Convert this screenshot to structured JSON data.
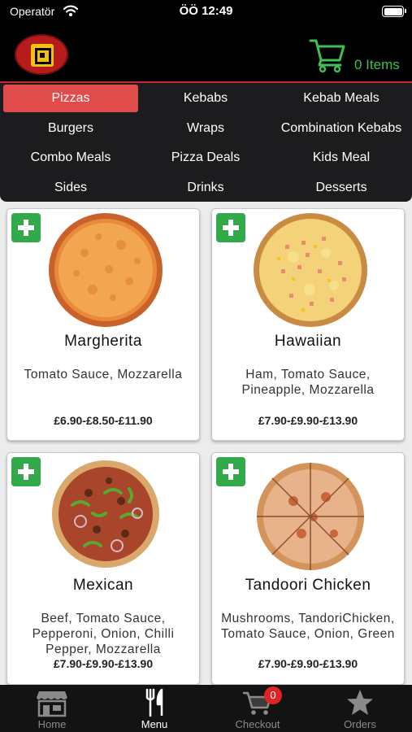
{
  "status_bar": {
    "carrier": "Operatör",
    "time": "ÖÖ 12:49"
  },
  "header": {
    "cart_count_label": "0 Items"
  },
  "categories": [
    {
      "label": "Pizzas",
      "active": true
    },
    {
      "label": "Kebabs"
    },
    {
      "label": "Kebab Meals"
    },
    {
      "label": "Burgers"
    },
    {
      "label": "Wraps"
    },
    {
      "label": "Combination Kebabs"
    },
    {
      "label": "Combo Meals"
    },
    {
      "label": "Pizza Deals"
    },
    {
      "label": "Kids Meal"
    },
    {
      "label": "Sides"
    },
    {
      "label": "Drinks"
    },
    {
      "label": "Desserts"
    }
  ],
  "products": [
    {
      "name": "Margherita",
      "description": "Tomato Sauce, Mozzarella",
      "price": "£6.90-£8.50-£11.90"
    },
    {
      "name": "Hawaiian",
      "description": "Ham, Tomato Sauce, Pineapple, Mozzarella",
      "price": "£7.90-£9.90-£13.90"
    },
    {
      "name": "Mexican",
      "description": "Beef, Tomato Sauce, Pepperoni, Onion, Chilli Pepper, Mozzarella",
      "price": "£7.90-£9.90-£13.90"
    },
    {
      "name": "Tandoori Chicken",
      "description": "Mushrooms, TandoriChicken, Tomato Sauce, Onion, Green",
      "price": "£7.90-£9.90-£13.90"
    }
  ],
  "tab_bar": {
    "items": [
      {
        "label": "Home",
        "icon": "store-icon"
      },
      {
        "label": "Menu",
        "icon": "fork-knife-icon",
        "active": true
      },
      {
        "label": "Checkout",
        "icon": "cart-icon",
        "badge": "0"
      },
      {
        "label": "Orders",
        "icon": "star-icon"
      }
    ]
  },
  "colors": {
    "accent_green": "#33aa4a",
    "active_category": "#e04b4b",
    "badge_red": "#e02424",
    "nav_bg": "#1c1c1e"
  }
}
